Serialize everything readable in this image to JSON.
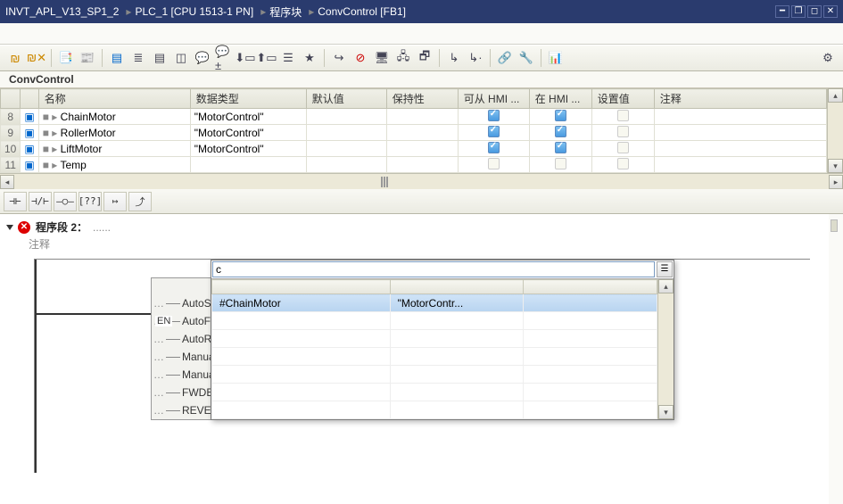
{
  "titlebar": {
    "crumbs": [
      "INVT_APL_V13_SP1_2",
      "PLC_1 [CPU 1513-1 PN]",
      "程序块",
      "ConvControl [FB1]"
    ]
  },
  "block": {
    "name": "ConvControl"
  },
  "vartable": {
    "headers": [
      "名称",
      "数据类型",
      "默认值",
      "保持性",
      "可从 HMI ...",
      "在 HMI ...",
      "设置值",
      "注释"
    ],
    "rows": [
      {
        "num": "8",
        "name": "ChainMotor",
        "type": "\"MotorControl\"",
        "hmi1": true,
        "hmi2": true,
        "setv": false
      },
      {
        "num": "9",
        "name": "RollerMotor",
        "type": "\"MotorControl\"",
        "hmi1": true,
        "hmi2": true,
        "setv": false
      },
      {
        "num": "10",
        "name": "LiftMotor",
        "type": "\"MotorControl\"",
        "hmi1": true,
        "hmi2": true,
        "setv": false
      },
      {
        "num": "11",
        "name": "Temp",
        "type": "",
        "hmi1": false,
        "hmi2": false,
        "setv": false
      }
    ]
  },
  "ladtoolbar": {
    "btns": [
      "⊣⊢",
      "⊣/⊢",
      "–○–",
      "[??]",
      "↦",
      "⤴"
    ]
  },
  "network": {
    "title": "程序段 2：",
    "dots": "......",
    "comment": "注释",
    "en": "EN",
    "pins": [
      "AutoSw",
      "AutoFW",
      "AutoRE",
      "Manua",
      "Manua",
      "FWDEndSensor",
      "REVEndSensor"
    ]
  },
  "autocomplete": {
    "input": "c",
    "rows": [
      {
        "name": "#ChainMotor",
        "type": "\"MotorContr..."
      }
    ]
  }
}
